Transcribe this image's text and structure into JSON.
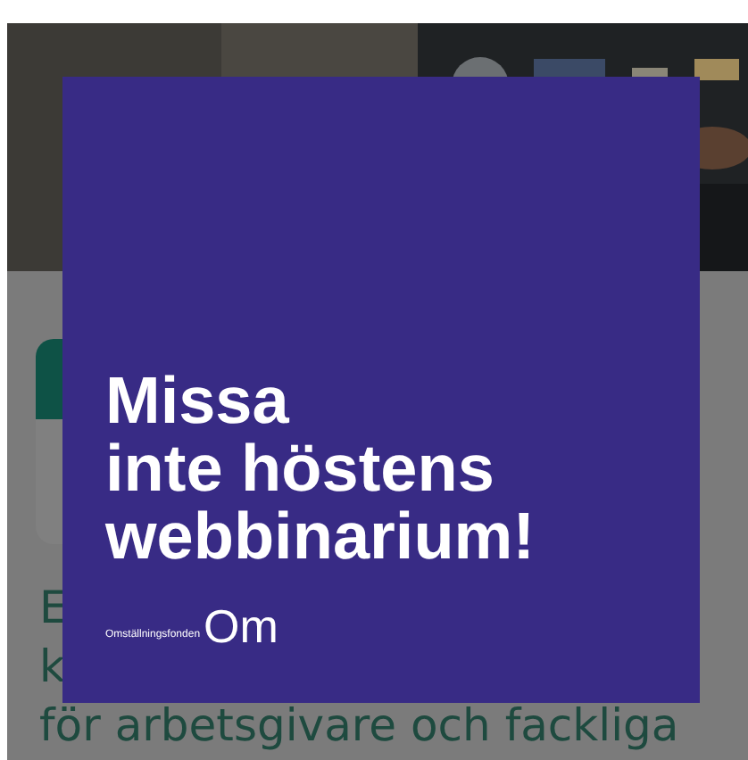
{
  "background": {
    "article_lines": [
      "E",
      "k",
      "för arbetsgivare och fackliga"
    ]
  },
  "popup": {
    "headline": [
      "Missa",
      "inte höstens",
      "webbinarium!"
    ],
    "logo": {
      "name": "Omställningsfonden",
      "mark": "Om"
    }
  }
}
